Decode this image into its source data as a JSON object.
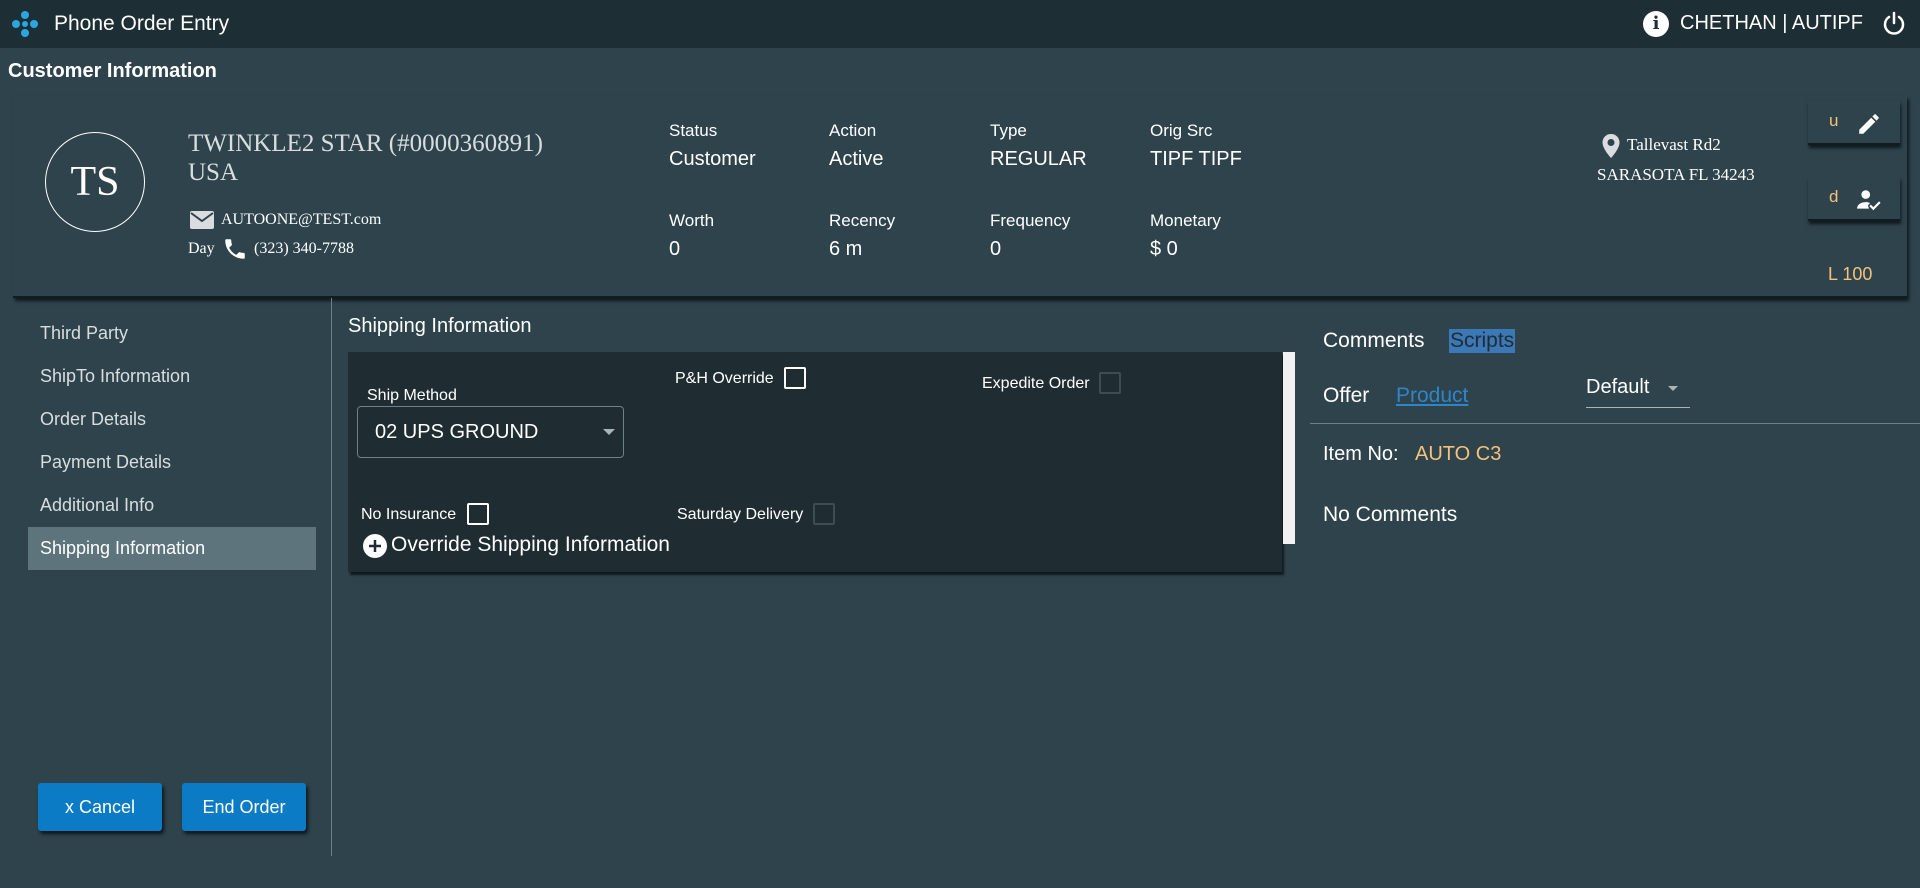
{
  "header": {
    "app_title": "Phone Order Entry",
    "user": "CHETHAN | AUTIPF",
    "icons": [
      "app-logo-icon",
      "info-icon",
      "power-icon"
    ]
  },
  "section_title": "Customer Information",
  "customer": {
    "initials": "TS",
    "name": "TWINKLE2 STAR (#0000360891)",
    "country": "USA",
    "email": "AUTOONE@TEST.com",
    "phone_label": "Day",
    "phone": "(323) 340-7788",
    "stats": [
      {
        "label": "Status",
        "value": "Customer"
      },
      {
        "label": "Action",
        "value": "Active"
      },
      {
        "label": "Type",
        "value": "REGULAR"
      },
      {
        "label": "Orig Src",
        "value": "TIPF TIPF"
      },
      {
        "label": "Worth",
        "value": "0"
      },
      {
        "label": "Recency",
        "value": "6 m"
      },
      {
        "label": "Frequency",
        "value": "0"
      },
      {
        "label": "Monetary",
        "value": "$ 0"
      }
    ],
    "address_line1": "Tallevast Rd2",
    "address_line2": "SARASOTA FL 34243",
    "edit_button_label": "u",
    "verify_button_label": "d",
    "level": "L 100"
  },
  "sidebar": {
    "items": [
      {
        "label": "Third Party"
      },
      {
        "label": "ShipTo Information"
      },
      {
        "label": "Order Details"
      },
      {
        "label": "Payment Details"
      },
      {
        "label": "Additional Info"
      },
      {
        "label": "Shipping Information",
        "active": true
      }
    ],
    "cancel_label": "x  Cancel",
    "end_order_label": "End Order"
  },
  "shipping": {
    "title": "Shipping Information",
    "ship_method_label": "Ship Method",
    "ship_method_value": "02 UPS GROUND",
    "ph_override_label": "P&H Override",
    "expedite_label": "Expedite Order",
    "no_insurance_label": "No Insurance",
    "saturday_label": "Saturday Delivery",
    "override_label": "Override Shipping Information"
  },
  "comments_panel": {
    "tabs": [
      "Comments",
      "Scripts"
    ],
    "offer_label": "Offer",
    "product_link": "Product",
    "default_select": "Default",
    "item_no_label": "Item No:",
    "item_no_value": "AUTO C3",
    "no_comments": "No Comments"
  }
}
